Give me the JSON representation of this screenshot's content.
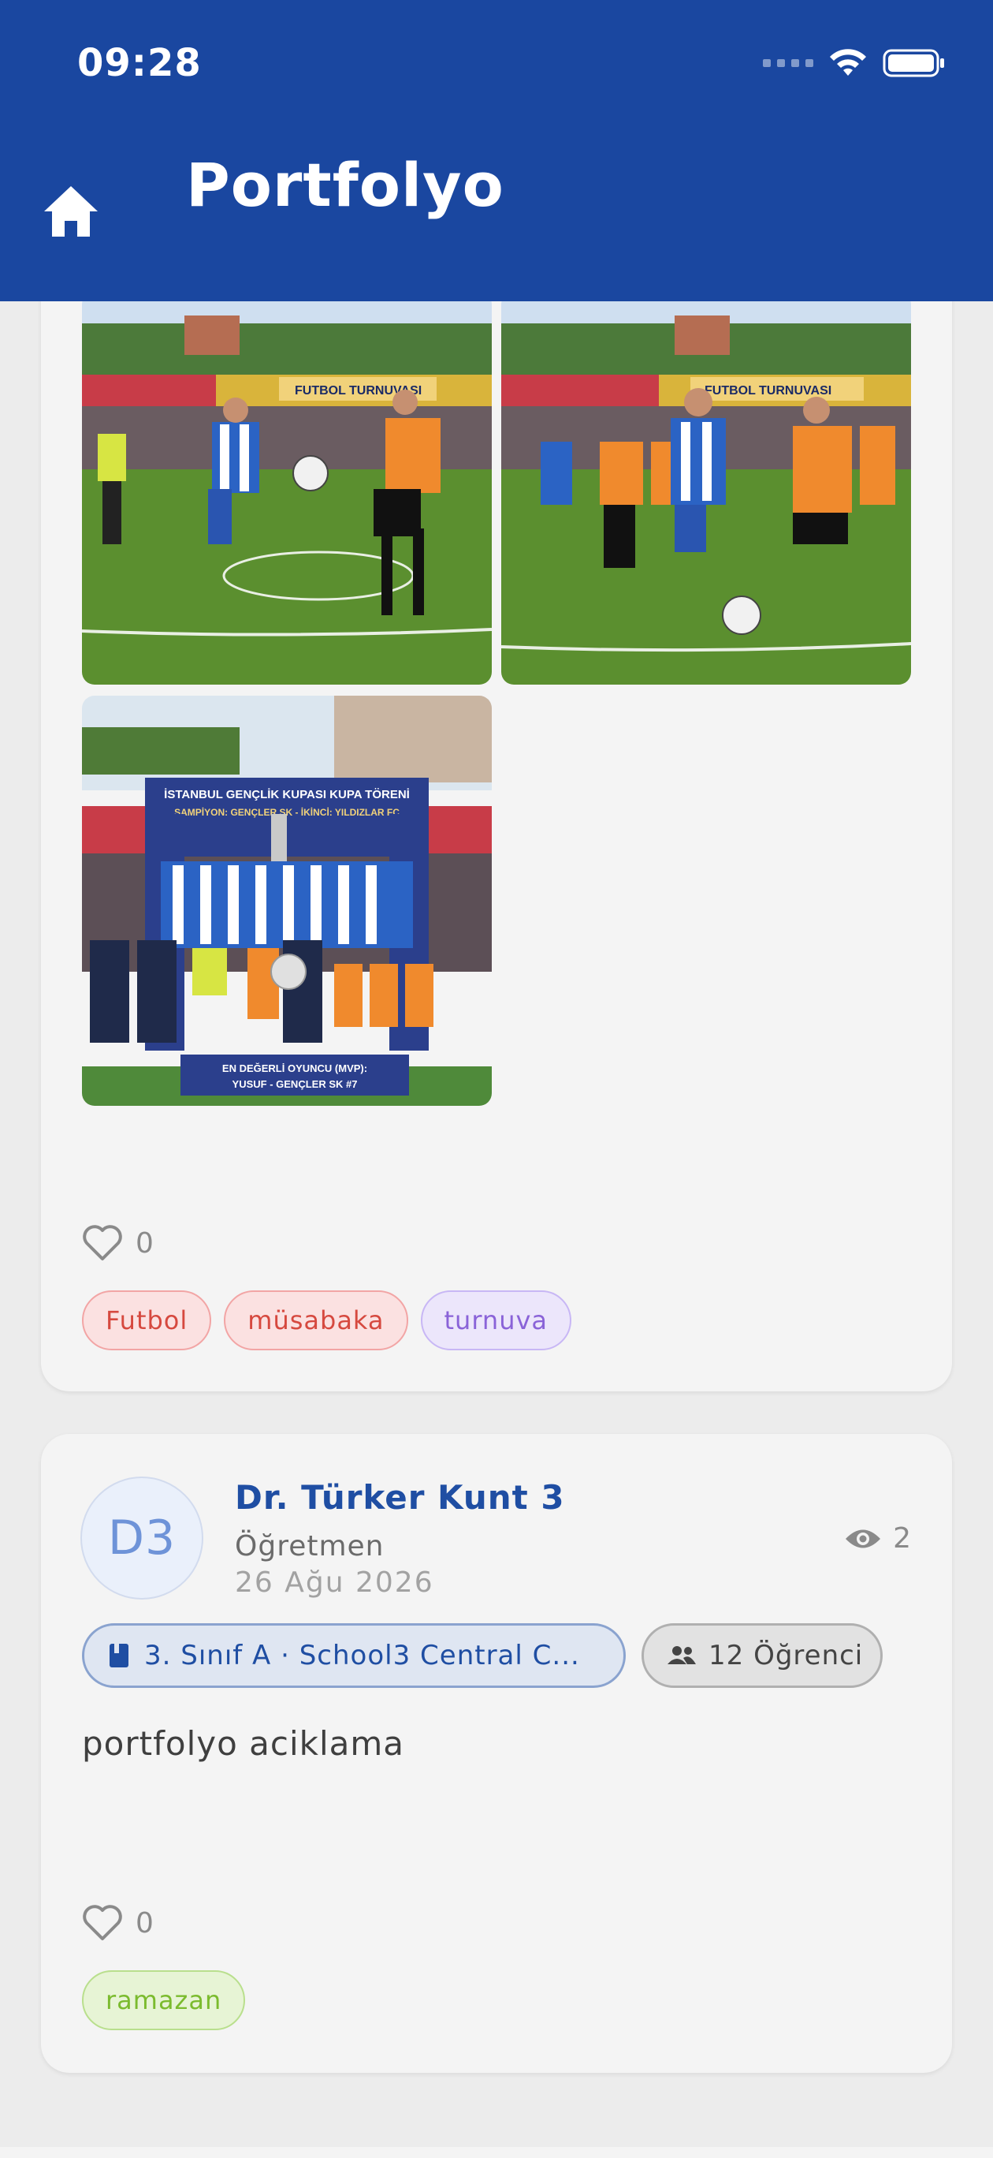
{
  "status_bar": {
    "time": "09:28",
    "wifi_icon": "wifi-icon",
    "battery_icon": "battery-icon"
  },
  "header": {
    "title": "Portfolyo",
    "home_icon": "home-icon",
    "background": "#1a47a0"
  },
  "posts": [
    {
      "photos": [
        {
          "name": "football-match-photo-1",
          "visible_text": "FUTBOL TURNUVASI"
        },
        {
          "name": "football-match-photo-2",
          "visible_text": "FUTBOL TURNUVASI"
        },
        {
          "name": "award-ceremony-photo",
          "visible_text": "İSTANBUL GENÇLİK KUPASI KUPA TÖRENİ",
          "banner_line2": "ŞAMPİYON: GENÇLER SK - İKİNCİ: YILDIZLAR FC",
          "mvp_line1": "EN DEĞERLİ OYUNCU (MVP):",
          "mvp_line2": "YUSUF - GENÇLER SK #7"
        }
      ],
      "like_count": "0",
      "tags": [
        {
          "label": "Futbol",
          "style": "red"
        },
        {
          "label": "müsabaka",
          "style": "red"
        },
        {
          "label": "turnuva",
          "style": "purple"
        }
      ]
    },
    {
      "author": {
        "initials": "D3",
        "name": "Dr. Türker Kunt 3",
        "role": "Öğretmen",
        "date": "26 Ağu 2026"
      },
      "view_count": "2",
      "class_chip": "3. Sınıf A · School3 Central C...",
      "students_chip": "12 Öğrenci",
      "description": "portfolyo aciklama",
      "like_count": "0",
      "tags": [
        {
          "label": "ramazan",
          "style": "green"
        }
      ]
    }
  ],
  "colors": {
    "accent": "#1f4ea3",
    "tag_red": "#d6493f",
    "tag_purple": "#8a63d8",
    "tag_green": "#7bbb2e"
  }
}
